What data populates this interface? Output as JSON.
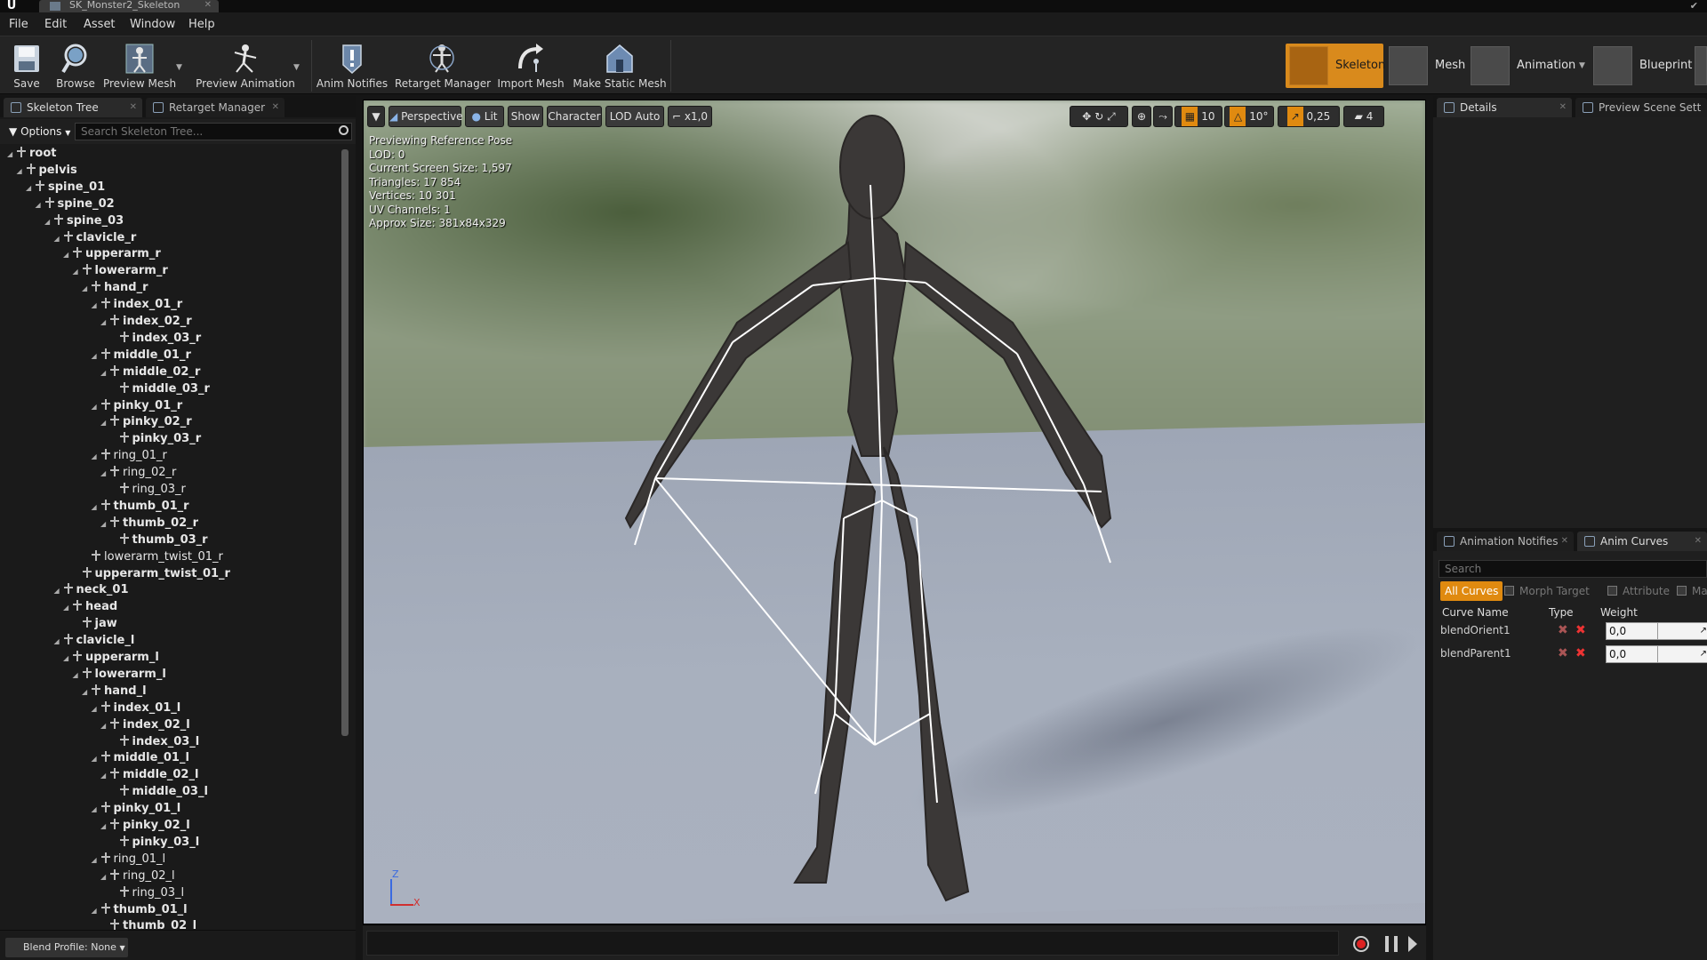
{
  "title_bar": {
    "tab_label": "SK_Monster2_Skeleton"
  },
  "menu": {
    "items": [
      "File",
      "Edit",
      "Asset",
      "Window",
      "Help"
    ]
  },
  "toolbar": {
    "buttons": [
      "Save",
      "Browse",
      "Preview Mesh",
      "Preview Animation",
      "Anim Notifies",
      "Retarget Manager",
      "Import Mesh",
      "Make Static Mesh"
    ],
    "modes": [
      "Skeleton",
      "Mesh",
      "Animation",
      "Blueprint"
    ],
    "active_mode": "Skeleton"
  },
  "left_panel": {
    "tabs": [
      "Skeleton Tree",
      "Retarget Manager"
    ],
    "options_label": "Options",
    "search_placeholder": "Search Skeleton Tree...",
    "blend_profile_label": "Blend Profile: None",
    "bones": [
      {
        "name": "root",
        "depth": 0,
        "bold": true
      },
      {
        "name": "pelvis",
        "depth": 1,
        "bold": true
      },
      {
        "name": "spine_01",
        "depth": 2,
        "bold": true
      },
      {
        "name": "spine_02",
        "depth": 3,
        "bold": true
      },
      {
        "name": "spine_03",
        "depth": 4,
        "bold": true
      },
      {
        "name": "clavicle_r",
        "depth": 5,
        "bold": true
      },
      {
        "name": "upperarm_r",
        "depth": 6,
        "bold": true
      },
      {
        "name": "lowerarm_r",
        "depth": 7,
        "bold": true
      },
      {
        "name": "hand_r",
        "depth": 8,
        "bold": true
      },
      {
        "name": "index_01_r",
        "depth": 9,
        "bold": true
      },
      {
        "name": "index_02_r",
        "depth": 10,
        "bold": true
      },
      {
        "name": "index_03_r",
        "depth": 11,
        "bold": true
      },
      {
        "name": "middle_01_r",
        "depth": 9,
        "bold": true
      },
      {
        "name": "middle_02_r",
        "depth": 10,
        "bold": true
      },
      {
        "name": "middle_03_r",
        "depth": 11,
        "bold": true
      },
      {
        "name": "pinky_01_r",
        "depth": 9,
        "bold": true
      },
      {
        "name": "pinky_02_r",
        "depth": 10,
        "bold": true
      },
      {
        "name": "pinky_03_r",
        "depth": 11,
        "bold": true
      },
      {
        "name": "ring_01_r",
        "depth": 9,
        "bold": false
      },
      {
        "name": "ring_02_r",
        "depth": 10,
        "bold": false
      },
      {
        "name": "ring_03_r",
        "depth": 11,
        "bold": false
      },
      {
        "name": "thumb_01_r",
        "depth": 9,
        "bold": true
      },
      {
        "name": "thumb_02_r",
        "depth": 10,
        "bold": true
      },
      {
        "name": "thumb_03_r",
        "depth": 11,
        "bold": true
      },
      {
        "name": "lowerarm_twist_01_r",
        "depth": 8,
        "bold": false
      },
      {
        "name": "upperarm_twist_01_r",
        "depth": 7,
        "bold": true
      },
      {
        "name": "neck_01",
        "depth": 5,
        "bold": true
      },
      {
        "name": "head",
        "depth": 6,
        "bold": true
      },
      {
        "name": "jaw",
        "depth": 7,
        "bold": true
      },
      {
        "name": "clavicle_l",
        "depth": 5,
        "bold": true
      },
      {
        "name": "upperarm_l",
        "depth": 6,
        "bold": true
      },
      {
        "name": "lowerarm_l",
        "depth": 7,
        "bold": true
      },
      {
        "name": "hand_l",
        "depth": 8,
        "bold": true
      },
      {
        "name": "index_01_l",
        "depth": 9,
        "bold": true
      },
      {
        "name": "index_02_l",
        "depth": 10,
        "bold": true
      },
      {
        "name": "index_03_l",
        "depth": 11,
        "bold": true
      },
      {
        "name": "middle_01_l",
        "depth": 9,
        "bold": true
      },
      {
        "name": "middle_02_l",
        "depth": 10,
        "bold": true
      },
      {
        "name": "middle_03_l",
        "depth": 11,
        "bold": true
      },
      {
        "name": "pinky_01_l",
        "depth": 9,
        "bold": true
      },
      {
        "name": "pinky_02_l",
        "depth": 10,
        "bold": true
      },
      {
        "name": "pinky_03_l",
        "depth": 11,
        "bold": true
      },
      {
        "name": "ring_01_l",
        "depth": 9,
        "bold": false
      },
      {
        "name": "ring_02_l",
        "depth": 10,
        "bold": false
      },
      {
        "name": "ring_03_l",
        "depth": 11,
        "bold": false
      },
      {
        "name": "thumb_01_l",
        "depth": 9,
        "bold": true
      },
      {
        "name": "thumb_02_l",
        "depth": 10,
        "bold": true
      }
    ]
  },
  "viewport": {
    "controls": {
      "perspective": "Perspective",
      "lit": "Lit",
      "show": "Show",
      "character": "Character",
      "lod": "LOD Auto",
      "speed": "x1,0",
      "grid_snap": "10",
      "rot_snap": "10°",
      "scale_snap": "0,25",
      "camera_speed": "4"
    },
    "info": [
      "Previewing Reference Pose",
      "LOD: 0",
      "Current Screen Size: 1,597",
      "Triangles: 17 854",
      "Vertices: 10 301",
      "UV Channels: 1",
      "Approx Size: 381x84x329"
    ],
    "axis_labels": {
      "z": "Z",
      "x": "X"
    }
  },
  "details_panel": {
    "tabs": [
      "Details",
      "Preview Scene Sett"
    ]
  },
  "curves_panel": {
    "tabs": [
      "Animation Notifies",
      "Anim Curves"
    ],
    "search_placeholder": "Search",
    "filters": [
      "All Curves",
      "Morph Target",
      "Attribute",
      "Ma"
    ],
    "columns": [
      "Curve Name",
      "Type",
      "Weight"
    ],
    "curves": [
      {
        "name": "blendOrient1",
        "weight": "0,0"
      },
      {
        "name": "blendParent1",
        "weight": "0,0"
      }
    ]
  },
  "colors": {
    "accent": "#e08a10",
    "record": "#dd2222"
  }
}
